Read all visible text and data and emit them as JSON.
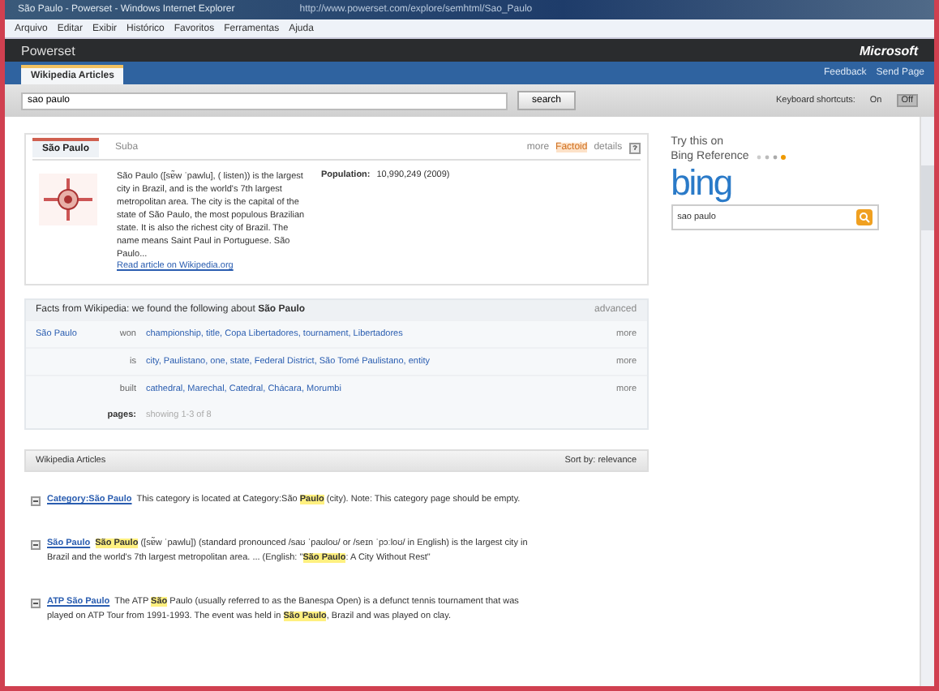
{
  "window": {
    "title": "São Paulo - Powerset - Windows Internet Explorer",
    "address": "http://www.powerset.com/explore/semhtml/Sao_Paulo"
  },
  "menu": [
    "Arquivo",
    "Editar",
    "Exibir",
    "Histórico",
    "Favoritos",
    "Ferramentas",
    "Ajuda"
  ],
  "header": {
    "logo": "Powerset",
    "brand": "Microsoft"
  },
  "tabs": [
    {
      "label": "Wikipedia Articles",
      "selected": true
    }
  ],
  "header_links": [
    "Feedback",
    "Send Page"
  ],
  "search": {
    "value": "sao paulo",
    "button": "search",
    "shortcuts_label": "Keyboard shortcuts:",
    "shortcuts": [
      {
        "label": "On",
        "selected": false
      },
      {
        "label": "Off",
        "selected": true
      }
    ]
  },
  "article": {
    "tabs": [
      {
        "label": "São Paulo",
        "selected": true
      },
      {
        "label": "Suba",
        "selected": false
      }
    ],
    "top_links": [
      "more",
      "Factoid",
      "details"
    ],
    "summary": "São Paulo ([sɐ̃w ˈpawlu], ( listen)) is the largest city in Brazil, and is the world's 7th largest metropolitan area. The city is the capital of the state of São Paulo, the most populous Brazilian state. It is also the richest city of Brazil. The name means Saint Paul in Portuguese. São Paulo...",
    "read_link": "Read article on Wikipedia.org",
    "population_label": "Population:",
    "population_value": "10,990,249 (2009)"
  },
  "facts": {
    "intro": "Facts from Wikipedia: we found the following about **São Paulo**",
    "action": "advanced",
    "subject": "São Paulo",
    "rows": [
      {
        "verb": "won",
        "objects": "championship, title, Copa Libertadores, tournament, Libertadores",
        "more": "more"
      },
      {
        "verb": "is",
        "objects": "city, Paulistano, one, state, Federal District, São Tomé Paulistano, entity",
        "more": "more"
      },
      {
        "verb": "built",
        "objects": "cathedral, Marechal, Catedral, Chácara, Morumbi",
        "more": "more"
      }
    ],
    "pages_label": "pages:",
    "pages_value": "showing 1-3 of 8"
  },
  "results": {
    "title": "Wikipedia Articles",
    "sort": "Sort by: relevance",
    "items": [
      {
        "title": "Category:São Paulo",
        "snippet": "This category is located at Category:São **Paulo** (city). Note: This category page should be empty."
      },
      {
        "title": "São Paulo",
        "snippet": "**São Paulo** ([sɐ̃w ˈpawlu]) (standard pronounced /saʊ ˈpaʊloʊ/ or /seɪn ˈpɔːloʊ/ in English) is the largest city in Brazil and the world's 7th largest metropolitan area. ... (English: \"**São Paulo**: A City Without Rest\""
      },
      {
        "title": "ATP São Paulo",
        "snippet": "The ATP **São** Paulo (usually referred to as the Banespa Open) is a defunct tennis tournament that was played on ATP Tour from 1991-1993. The event was held in **São Paulo**, Brazil and was played on clay."
      }
    ]
  },
  "sidebar": {
    "try_label": "Try this on",
    "reference": "Bing Reference",
    "logo": "bing",
    "search_value": "sao paulo"
  }
}
